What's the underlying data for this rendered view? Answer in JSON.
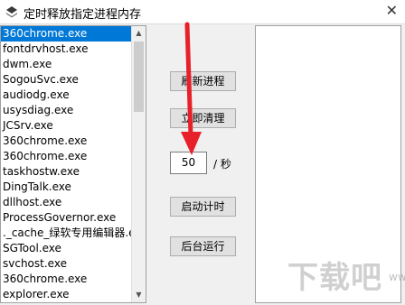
{
  "window": {
    "title": "定时释放指定进程内存",
    "close": "✕"
  },
  "processes": [
    "360chrome.exe",
    "fontdrvhost.exe",
    "dwm.exe",
    "SogouSvc.exe",
    "audiodg.exe",
    "usysdiag.exe",
    "JCSrv.exe",
    "360chrome.exe",
    "360chrome.exe",
    "taskhostw.exe",
    "DingTalk.exe",
    "dllhost.exe",
    "ProcessGovernor.exe",
    "._cache_绿软专用编辑器.exe",
    "SGTool.exe",
    "svchost.exe",
    "360chrome.exe",
    "explorer.exe"
  ],
  "controls": {
    "refresh": "刷新进程",
    "clear_now": "立即清理",
    "interval_value": "50",
    "interval_unit": "/ 秒",
    "start_timer": "启动计时",
    "background": "后台运行"
  },
  "scrollbar": {
    "up": "▲",
    "down": "▼"
  },
  "watermark": {
    "text": "下载吧",
    "sub": "www"
  },
  "colors": {
    "selection": "#0078d7",
    "arrow": "#e8202a"
  }
}
